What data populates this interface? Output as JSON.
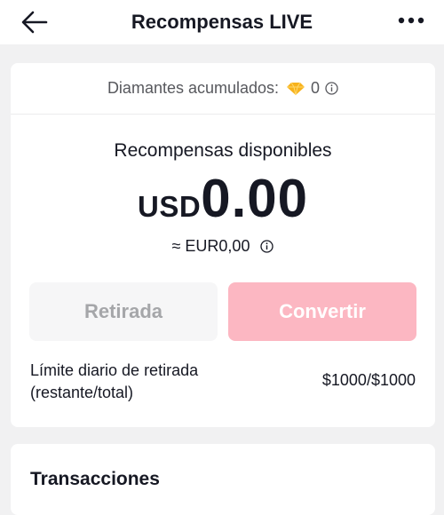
{
  "header": {
    "title": "Recompensas LIVE"
  },
  "diamonds": {
    "label": "Diamantes acumulados:",
    "count": "0"
  },
  "rewards": {
    "label": "Recompensas disponibles",
    "currency": "USD",
    "amount": "0.00",
    "converted": "≈ EUR0,00"
  },
  "buttons": {
    "withdraw": "Retirada",
    "convert": "Convertir"
  },
  "limit": {
    "label_line1": "Límite diario de retirada",
    "label_line2": "(restante/total)",
    "value": "$1000/$1000"
  },
  "transactions": {
    "title": "Transacciones"
  },
  "colors": {
    "accent_disabled": "#fcb7c2",
    "gem": "#f7b21c"
  }
}
